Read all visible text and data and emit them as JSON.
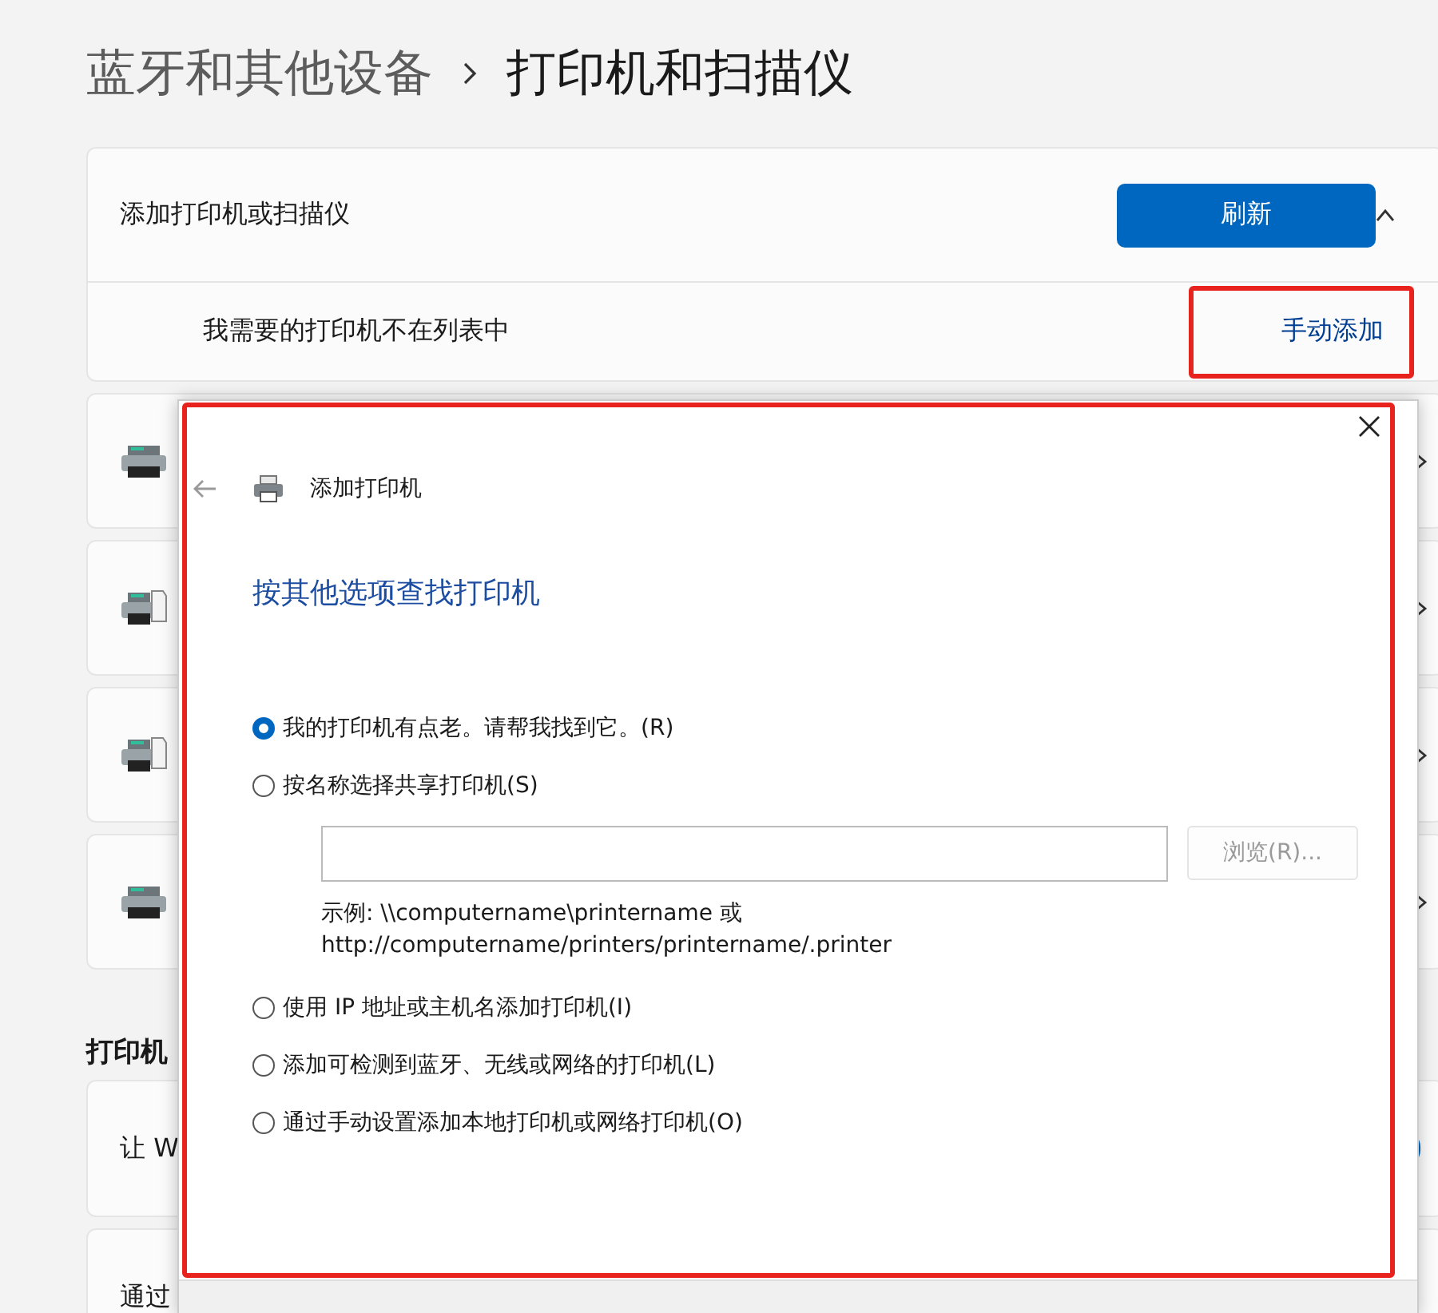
{
  "breadcrumb": {
    "parent": "蓝牙和其他设备",
    "current": "打印机和扫描仪"
  },
  "add_section": {
    "label": "添加打印机或扫描仪",
    "button": "刷新",
    "expanded": true,
    "manual_row": {
      "label": "我需要的打印机不在列表中",
      "link": "手动添加"
    }
  },
  "printers": [
    {
      "kind": "printer"
    },
    {
      "kind": "fax"
    },
    {
      "kind": "fax"
    },
    {
      "kind": "printer"
    }
  ],
  "section_heading": "打印机",
  "settings": [
    {
      "kind": "toggle",
      "label": "让 W",
      "on": true
    },
    {
      "kind": "plain",
      "label": "通过"
    }
  ],
  "dialog": {
    "title": "添加打印机",
    "heading": "按其他选项查找打印机",
    "options": [
      {
        "label": "我的打印机有点老。请帮我找到它。(R)",
        "selected": true
      },
      {
        "label": "按名称选择共享打印机(S)",
        "selected": false,
        "share": {
          "browse": "浏览(R)...",
          "browse_disabled": true,
          "example": [
            "示例: \\\\computername\\printername 或",
            "http://computername/printers/printername/.printer"
          ]
        }
      },
      {
        "label": "使用 IP 地址或主机名添加打印机(I)",
        "selected": false
      },
      {
        "label": "添加可检测到蓝牙、无线或网络的打印机(L)",
        "selected": false
      },
      {
        "label": "通过手动设置添加本地打印机或网络打印机(O)",
        "selected": false
      }
    ]
  }
}
